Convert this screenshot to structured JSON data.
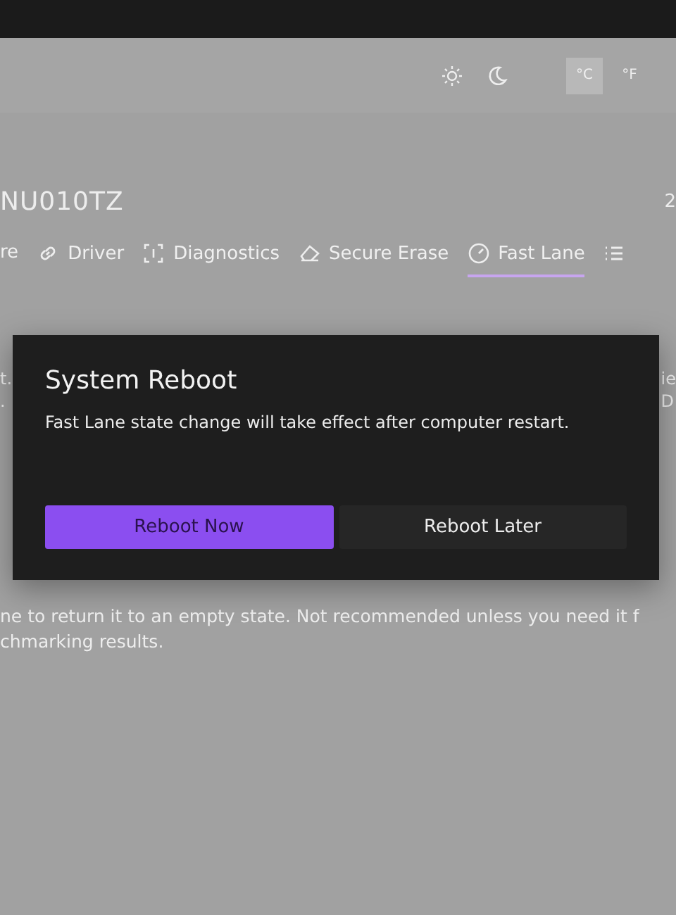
{
  "unit_toggle": [
    {
      "label": "°C",
      "selected": true
    },
    {
      "label": "°F",
      "selected": false
    }
  ],
  "device": {
    "title": "NU010TZ",
    "right_text": "2"
  },
  "tabs": [
    {
      "label": "re",
      "selected": false
    },
    {
      "label": "Driver",
      "selected": false
    },
    {
      "label": "Diagnostics",
      "selected": false
    },
    {
      "label": "Secure Erase",
      "selected": false
    },
    {
      "label": "Fast Lane",
      "selected": true
    },
    {
      "selected": false
    }
  ],
  "behind_left": [
    "t.",
    "."
  ],
  "behind_right": [
    "ie",
    "D"
  ],
  "body_lines": [
    "ne to return it to an empty state. Not recommended unless you need it f",
    "chmarking results."
  ],
  "dialog": {
    "title": "System Reboot",
    "message": "Fast Lane state change will take effect after computer restart.",
    "buttons": [
      {
        "label": "Reboot Now",
        "kind": "primary"
      },
      {
        "label": "Reboot Later",
        "kind": "secondary"
      }
    ]
  }
}
